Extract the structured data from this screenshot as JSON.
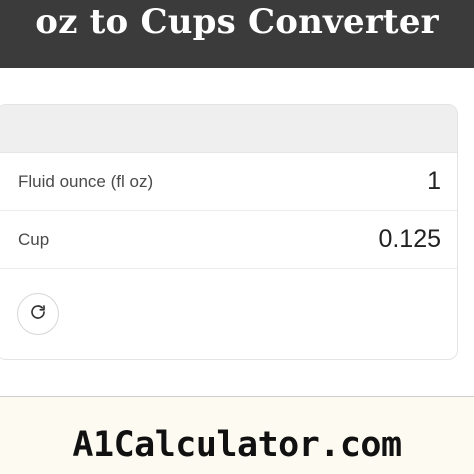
{
  "header": {
    "title": "oz to Cups Converter"
  },
  "converter": {
    "rows": [
      {
        "label": "Fluid ounce (fl oz)",
        "value": "1"
      },
      {
        "label": "Cup",
        "value": "0.125"
      }
    ],
    "reset_icon": "refresh-icon"
  },
  "footer": {
    "brand": "A1Calculator.com"
  },
  "colors": {
    "header_bg": "#3b3b3b",
    "card_header_bg": "#efefef",
    "footer_bg": "#fdfaf2"
  }
}
